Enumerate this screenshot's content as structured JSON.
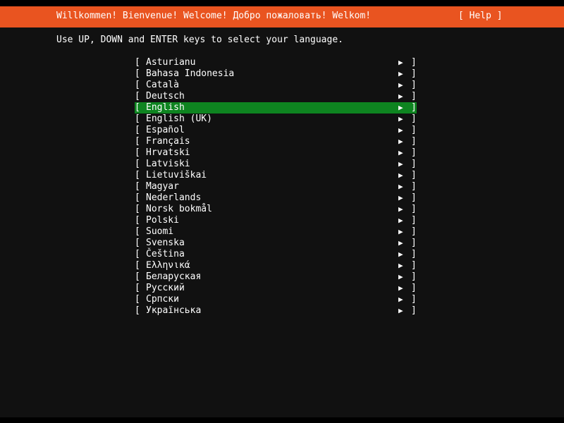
{
  "colors": {
    "header_background": "#e95420",
    "screen_background": "#111111",
    "selection_background": "#0e8420",
    "foreground": "#ffffff",
    "border_black": "#000000"
  },
  "header": {
    "greeting": "Willkommen! Bienvenue! Welcome! Добро пожаловать! Welkom!",
    "help_label": "[ Help ]"
  },
  "instruction": "Use UP, DOWN and ENTER keys to select your language.",
  "list": {
    "open_bracket": "[",
    "close_bracket": "]",
    "arrow_glyph": "▶",
    "selected_index": 4,
    "items": [
      {
        "label": "Asturianu"
      },
      {
        "label": "Bahasa Indonesia"
      },
      {
        "label": "Català"
      },
      {
        "label": "Deutsch"
      },
      {
        "label": "English"
      },
      {
        "label": "English (UK)"
      },
      {
        "label": "Español"
      },
      {
        "label": "Français"
      },
      {
        "label": "Hrvatski"
      },
      {
        "label": "Latviski"
      },
      {
        "label": "Lietuviškai"
      },
      {
        "label": "Magyar"
      },
      {
        "label": "Nederlands"
      },
      {
        "label": "Norsk bokmål"
      },
      {
        "label": "Polski"
      },
      {
        "label": "Suomi"
      },
      {
        "label": "Svenska"
      },
      {
        "label": "Čeština"
      },
      {
        "label": "Ελληνικά"
      },
      {
        "label": "Беларуская"
      },
      {
        "label": "Русский"
      },
      {
        "label": "Српски"
      },
      {
        "label": "Українська"
      }
    ]
  }
}
